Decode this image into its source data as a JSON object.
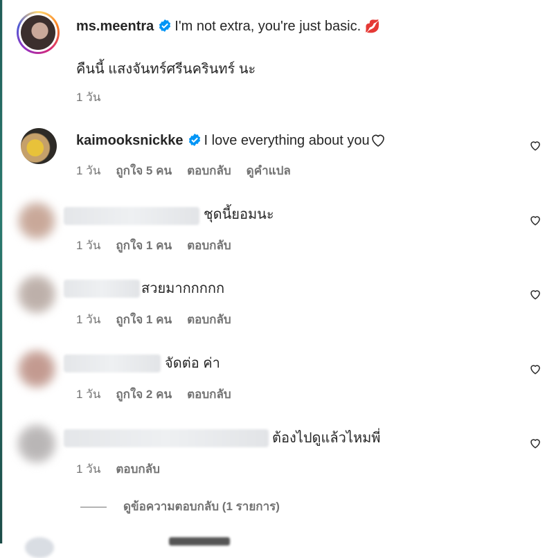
{
  "post": {
    "username": "ms.meentra",
    "caption": "I'm not extra, you're just basic.",
    "caption_emoji": "💋",
    "caption_line2": "คืนนี้ แสงจันทร์ศรีนครินทร์ นะ",
    "time": "1 วัน"
  },
  "comments": [
    {
      "username": "kaimooksnickke",
      "text": "I love everything about you",
      "time": "1 วัน",
      "likes": "ถูกใจ 5 คน",
      "reply": "ตอบกลับ",
      "translate": "ดูคำแปล"
    },
    {
      "text": "ชุดนี้ยอมนะ",
      "time": "1 วัน",
      "likes": "ถูกใจ 1 คน",
      "reply": "ตอบกลับ"
    },
    {
      "text": "สวยมากกกกก",
      "time": "1 วัน",
      "likes": "ถูกใจ 1 คน",
      "reply": "ตอบกลับ"
    },
    {
      "text": "จัดต่อ ค่า",
      "time": "1 วัน",
      "likes": "ถูกใจ 2 คน",
      "reply": "ตอบกลับ"
    },
    {
      "text": "ต้องไปดูแล้วไหมพี่",
      "time": "1 วัน",
      "reply": "ตอบกลับ"
    }
  ],
  "view_replies": "ดูข้อความตอบกลับ (1 รายการ)",
  "colors": {
    "verified": "#0095f6",
    "meta_text": "#737373",
    "primary_text": "#262626"
  }
}
